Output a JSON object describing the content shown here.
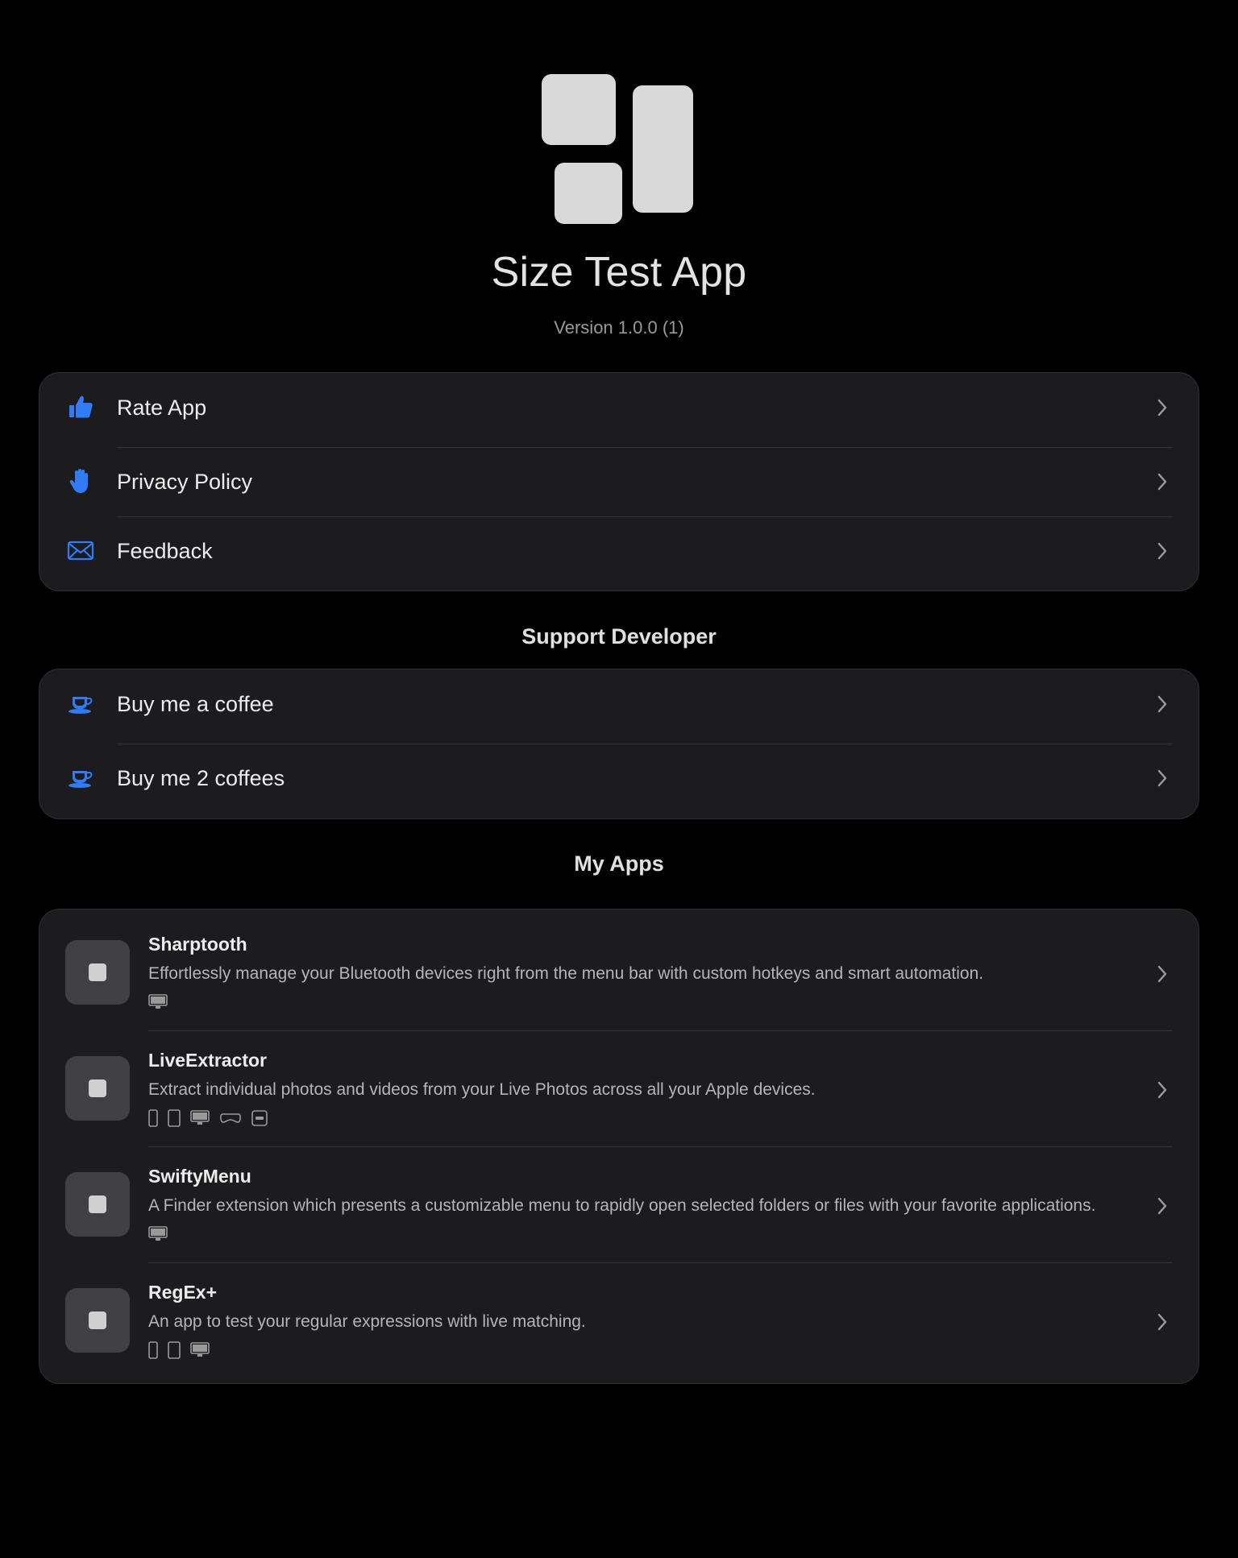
{
  "header": {
    "title": "Size Test App",
    "version": "Version 1.0.0 (1)",
    "icon": "app-tiles-icon"
  },
  "main_menu": {
    "items": [
      {
        "label": "Rate App",
        "icon": "thumbs-up-icon"
      },
      {
        "label": "Privacy Policy",
        "icon": "raised-hand-icon"
      },
      {
        "label": "Feedback",
        "icon": "envelope-icon"
      }
    ]
  },
  "support": {
    "title": "Support Developer",
    "items": [
      {
        "label": "Buy me a coffee",
        "icon": "coffee-cup-icon"
      },
      {
        "label": "Buy me 2 coffees",
        "icon": "coffee-cup-icon"
      }
    ]
  },
  "my_apps": {
    "title": "My Apps",
    "items": [
      {
        "name": "Sharptooth",
        "description": "Effortlessly manage your Bluetooth devices right from the menu bar with custom hotkeys and smart automation.",
        "platforms": [
          "mac"
        ]
      },
      {
        "name": "LiveExtractor",
        "description": "Extract individual photos and videos from your Live Photos across all your Apple devices.",
        "platforms": [
          "iphone",
          "ipad",
          "mac",
          "vision",
          "tv"
        ]
      },
      {
        "name": "SwiftyMenu",
        "description": "A Finder extension which presents a customizable menu to rapidly open selected folders or files with your favorite applications.",
        "platforms": [
          "mac"
        ]
      },
      {
        "name": "RegEx+",
        "description": "An app to test your regular expressions with live matching.",
        "platforms": [
          "iphone",
          "ipad",
          "mac"
        ]
      }
    ]
  },
  "colors": {
    "background": "#000000",
    "card": "#1c1c1e",
    "accent": "#2f7cf6",
    "text": "#ececec",
    "secondary_text": "#9a9a9a"
  }
}
